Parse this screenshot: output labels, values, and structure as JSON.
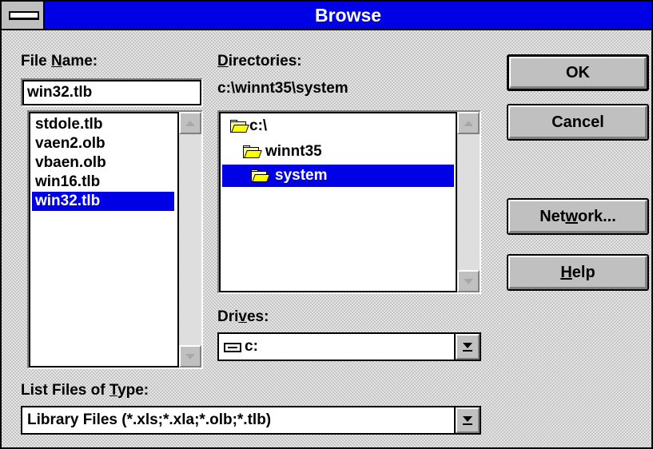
{
  "window": {
    "title": "Browse"
  },
  "file_name": {
    "label_pre": "File ",
    "label_accel": "N",
    "label_post": "ame:",
    "value": "win32.tlb",
    "files": [
      "stdole.tlb",
      "vaen2.olb",
      "vbaen.olb",
      "win16.tlb",
      "win32.tlb"
    ],
    "selected_index": 4
  },
  "directories": {
    "label_accel": "D",
    "label_post": "irectories:",
    "current_path": "c:\\winnt35\\system",
    "items": [
      "c:\\",
      "winnt35",
      "system"
    ],
    "selected_index": 2
  },
  "drives": {
    "label_pre": "Dri",
    "label_accel": "v",
    "label_post": "es:",
    "value": "c:"
  },
  "file_type": {
    "label_pre": "List Files of ",
    "label_accel": "T",
    "label_post": "ype:",
    "value": "Library Files (*.xls;*.xla;*.olb;*.tlb)"
  },
  "buttons": {
    "ok": "OK",
    "cancel": "Cancel",
    "network_pre": "Net",
    "network_accel": "w",
    "network_post": "ork...",
    "help_accel": "H",
    "help_post": "elp"
  },
  "colors": {
    "title_bar": "#0000e6",
    "selection": "#0000e6",
    "face": "#c0c0c0"
  }
}
